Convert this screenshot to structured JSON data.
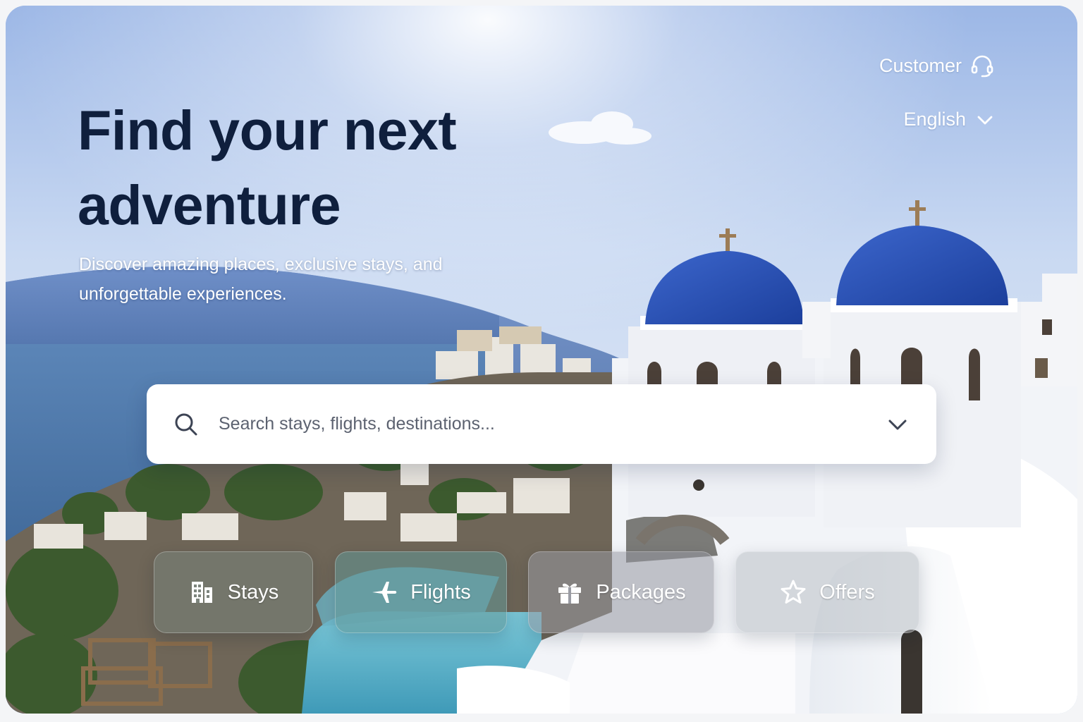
{
  "header": {
    "customer_label": "Customer",
    "customer_icon": "headset-icon",
    "language_label": "English",
    "language_icon": "chevron-down-icon"
  },
  "hero": {
    "title": "Find your next adventure",
    "subtitle": "Discover amazing places, exclusive stays, and unforgettable experiences."
  },
  "search": {
    "placeholder": "Search stays, flights, destinations...",
    "value": "",
    "icon": "search-icon",
    "dropdown_icon": "chevron-down-icon"
  },
  "categories": [
    {
      "label": "Stays",
      "icon": "building-icon"
    },
    {
      "label": "Flights",
      "icon": "airplane-icon"
    },
    {
      "label": "Packages",
      "icon": "gift-icon"
    },
    {
      "label": "Offers",
      "icon": "star-icon"
    }
  ],
  "colors": {
    "title": "#0f1f3d",
    "dome_blue": "#2a52b8",
    "sea": "#3d6b9a",
    "pool": "#5fb8cf"
  }
}
